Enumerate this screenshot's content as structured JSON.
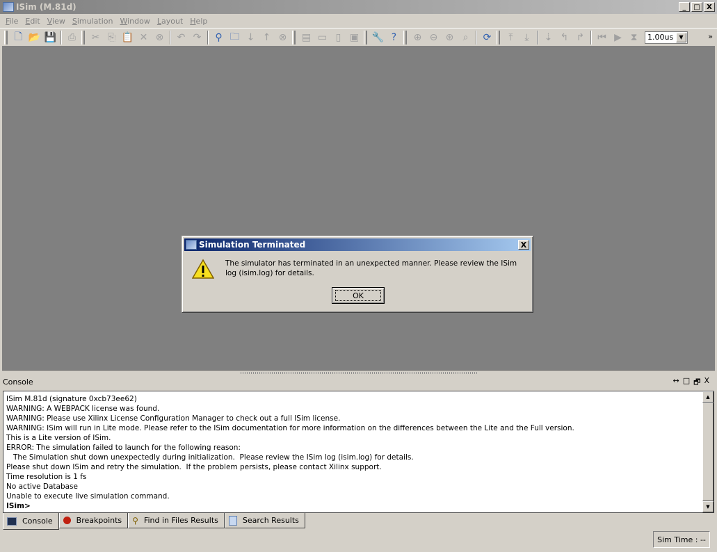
{
  "window": {
    "title": "ISim (M.81d)",
    "min": "_",
    "max": "□",
    "close": "X"
  },
  "menu": [
    "File",
    "Edit",
    "View",
    "Simulation",
    "Window",
    "Layout",
    "Help"
  ],
  "toolbar": {
    "groups": [
      [
        [
          "new-file-icon",
          "🗋"
        ],
        [
          "open-folder-icon",
          "📂"
        ],
        [
          "save-icon",
          "💾"
        ],
        [
          "|",
          ""
        ],
        [
          "print-icon",
          "⎙"
        ]
      ],
      [
        [
          "cut-icon",
          "✂"
        ],
        [
          "copy-icon",
          "⎘"
        ],
        [
          "paste-icon",
          "📋"
        ],
        [
          "delete-icon",
          "✕"
        ],
        [
          "find-icon",
          "⊗"
        ],
        [
          "|",
          ""
        ],
        [
          "undo-icon",
          "↶"
        ],
        [
          "redo-icon",
          "↷"
        ],
        [
          "|",
          ""
        ],
        [
          "binoculars-icon",
          "⚲"
        ],
        [
          "find-in-files-icon",
          "🗀"
        ],
        [
          "find-next-icon",
          "↓"
        ],
        [
          "find-previous-icon",
          "↑"
        ],
        [
          "stop-search-icon",
          "⊗"
        ]
      ],
      [
        [
          "cascade-icon",
          "▤"
        ],
        [
          "tile-horizontal-icon",
          "▭"
        ],
        [
          "tile-vertical-icon",
          "▯"
        ],
        [
          "arrange-icon",
          "▣"
        ]
      ],
      [
        [
          "wrench-icon",
          "🔧"
        ],
        [
          "whats-this-icon",
          "?"
        ]
      ],
      [
        [
          "zoom-in-icon",
          "⊕"
        ],
        [
          "zoom-out-icon",
          "⊖"
        ],
        [
          "zoom-fit-icon",
          "⊛"
        ],
        [
          "zoom-cursor-icon",
          "⌕"
        ],
        [
          "|",
          ""
        ],
        [
          "refresh-icon",
          "⟳"
        ]
      ],
      [
        [
          "previous-transition-icon",
          "⤒"
        ],
        [
          "next-transition-icon",
          "⤓"
        ],
        [
          "|",
          ""
        ],
        [
          "add-marker-icon",
          "⇣"
        ],
        [
          "go-previous-marker-icon",
          "↰"
        ],
        [
          "go-next-marker-icon",
          "↱"
        ],
        [
          "|",
          ""
        ],
        [
          "restart-icon",
          "⏮"
        ],
        [
          "run-all-icon",
          "▶"
        ],
        [
          "run-for-time-icon",
          "⧗"
        ]
      ]
    ],
    "time_value": "1.00us",
    "overflow": "»"
  },
  "dialog": {
    "title": "Simulation Terminated",
    "close": "X",
    "message": "The simulator has terminated in an unexpected manner.  Please review the ISim log (isim.log) for details.",
    "ok_label": "OK"
  },
  "console": {
    "title": "Console",
    "controls": [
      "↔",
      "□",
      "🗗",
      "X"
    ],
    "lines": [
      "ISim M.81d (signature 0xcb73ee62)",
      "WARNING: A WEBPACK license was found.",
      "WARNING: Please use Xilinx License Configuration Manager to check out a full ISim license.",
      "WARNING: ISim will run in Lite mode. Please refer to the ISim documentation for more information on the differences between the Lite and the Full version.",
      "This is a Lite version of ISim.",
      "ERROR: The simulation failed to launch for the following reason:",
      "   The Simulation shut down unexpectedly during initialization.  Please review the ISim log (isim.log) for details.",
      "Please shut down ISim and retry the simulation.  If the problem persists, please contact Xilinx support.",
      "Time resolution is 1 fs",
      "No active Database",
      "Unable to execute live simulation command."
    ],
    "prompt": "ISim>"
  },
  "tabs": [
    {
      "label": "Console",
      "icon": "console-icon"
    },
    {
      "label": "Breakpoints",
      "icon": "breakpoint-icon"
    },
    {
      "label": "Find in Files Results",
      "icon": "binoculars-icon"
    },
    {
      "label": "Search Results",
      "icon": "search-results-icon"
    }
  ],
  "status": {
    "sim_time": "Sim Time : --"
  }
}
